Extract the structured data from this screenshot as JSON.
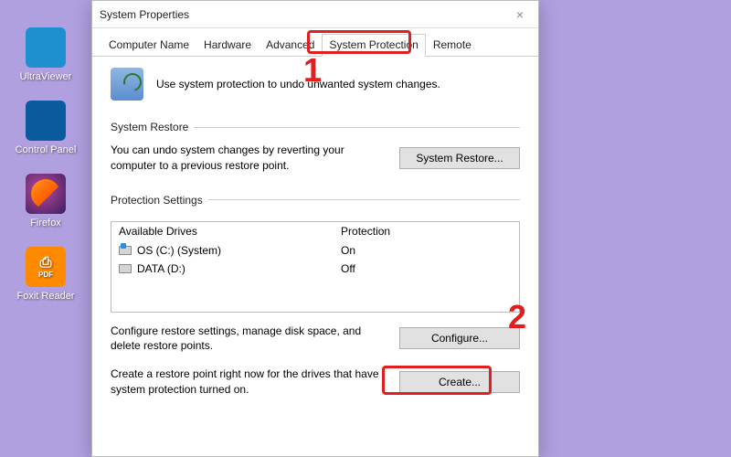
{
  "desktop": {
    "icons": [
      {
        "label": "UltraViewer"
      },
      {
        "label": "Control Panel"
      },
      {
        "label": "Firefox"
      },
      {
        "label": "Foxit Reader",
        "pdf": "PDF"
      }
    ]
  },
  "window": {
    "title": "System Properties",
    "close": "×",
    "tabs": [
      {
        "label": "Computer Name"
      },
      {
        "label": "Hardware"
      },
      {
        "label": "Advanced"
      },
      {
        "label": "System Protection"
      },
      {
        "label": "Remote"
      }
    ],
    "intro": "Use system protection to undo unwanted system changes.",
    "restore": {
      "legend": "System Restore",
      "desc": "You can undo system changes by reverting your computer to a previous restore point.",
      "button": "System Restore..."
    },
    "protection": {
      "legend": "Protection Settings",
      "headers": {
        "drive": "Available Drives",
        "prot": "Protection"
      },
      "drives": [
        {
          "name": "OS (C:) (System)",
          "status": "On"
        },
        {
          "name": "DATA (D:)",
          "status": "Off"
        }
      ],
      "configure": {
        "desc": "Configure restore settings, manage disk space, and delete restore points.",
        "button": "Configure..."
      },
      "create": {
        "desc": "Create a restore point right now for the drives that have system protection turned on.",
        "button": "Create..."
      }
    }
  },
  "annotations": {
    "num1": "1",
    "num2": "2"
  }
}
